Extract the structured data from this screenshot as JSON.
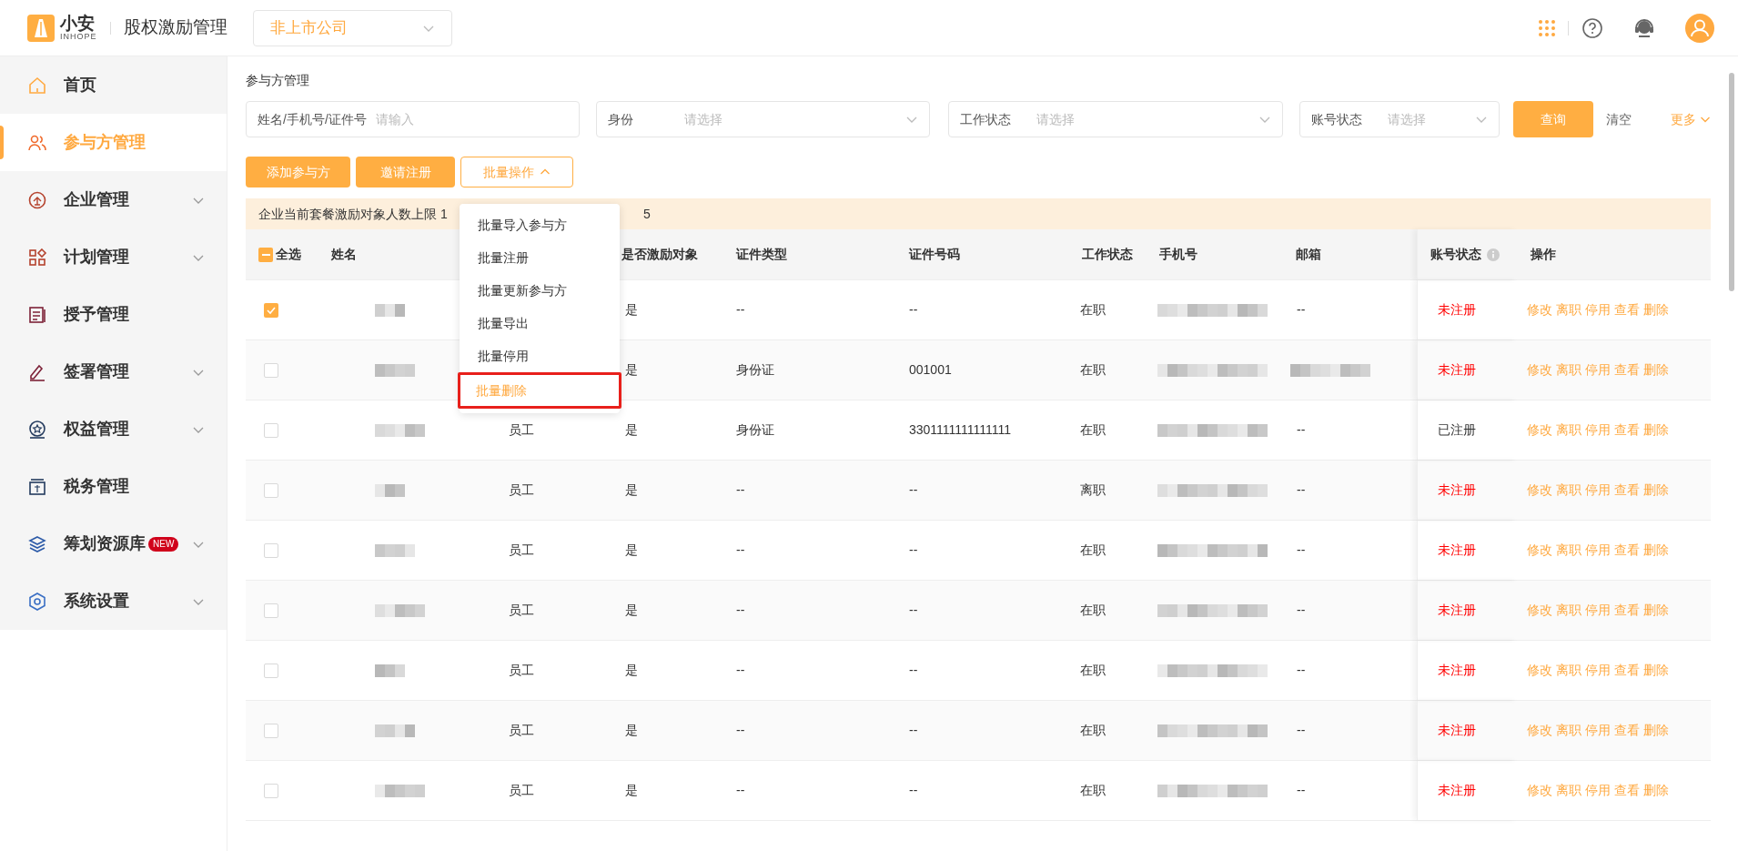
{
  "header": {
    "brand": "小安",
    "brand_sub": "INHOPE",
    "app_title": "股权激励管理",
    "company_select": "非上市公司"
  },
  "sidebar": {
    "items": [
      {
        "label": "首页",
        "selected": false,
        "has_children": false
      },
      {
        "label": "参与方管理",
        "selected": true,
        "has_children": false
      },
      {
        "label": "企业管理",
        "selected": false,
        "has_children": true
      },
      {
        "label": "计划管理",
        "selected": false,
        "has_children": true
      },
      {
        "label": "授予管理",
        "selected": false,
        "has_children": false
      },
      {
        "label": "签署管理",
        "selected": false,
        "has_children": true
      },
      {
        "label": "权益管理",
        "selected": false,
        "has_children": true
      },
      {
        "label": "税务管理",
        "selected": false,
        "has_children": false
      },
      {
        "label": "筹划资源库",
        "selected": false,
        "has_children": true,
        "badge": "NEW"
      },
      {
        "label": "系统设置",
        "selected": false,
        "has_children": true
      }
    ]
  },
  "breadcrumb": "参与方管理",
  "filters": [
    {
      "label": "姓名/手机号/证件号",
      "placeholder": "请输入",
      "kind": "input"
    },
    {
      "label": "身份",
      "placeholder": "请选择",
      "kind": "select"
    },
    {
      "label": "工作状态",
      "placeholder": "请选择",
      "kind": "select"
    },
    {
      "label": "账号状态",
      "placeholder": "请选择",
      "kind": "select"
    }
  ],
  "filter_actions": {
    "query": "查询",
    "clear": "清空",
    "more": "更多"
  },
  "actions": [
    {
      "label": "添加参与方",
      "kind": "primary"
    },
    {
      "label": "邀请注册",
      "kind": "primary"
    },
    {
      "label": "批量操作",
      "kind": "menu",
      "expanded": true
    }
  ],
  "batch_menu": [
    {
      "label": "批量导入参与方",
      "highlighted": false
    },
    {
      "label": "批量注册",
      "highlighted": false
    },
    {
      "label": "批量更新参与方",
      "highlighted": false
    },
    {
      "label": "批量导出",
      "highlighted": false
    },
    {
      "label": "批量停用",
      "highlighted": false
    },
    {
      "label": "批量删除",
      "highlighted": true
    }
  ],
  "notice": {
    "start": "企业当前套餐激励对象人数上限 1",
    "end": "5"
  },
  "table": {
    "select_all": {
      "label": "全选",
      "indeterminate": true
    },
    "columns": [
      "姓名",
      "是否激励对象",
      "证件类型",
      "证件号码",
      "工作状态",
      "手机号",
      "邮箱",
      "账号状态",
      "操作"
    ],
    "rows": [
      {
        "checked": true,
        "incentive": "是",
        "id_type": "--",
        "id_no": "--",
        "work": "在职",
        "email": "--",
        "account": "未注册",
        "registered": false,
        "actions": [
          "修改",
          "离职",
          "停用",
          "查看",
          "删除"
        ]
      },
      {
        "checked": false,
        "incentive": "是",
        "id_type": "身份证",
        "id_no": "001001",
        "work": "在职",
        "email_blurred": true,
        "account": "未注册",
        "registered": false,
        "actions": [
          "修改",
          "离职",
          "停用",
          "查看",
          "删除"
        ]
      },
      {
        "checked": false,
        "identity": "员工",
        "incentive": "是",
        "id_type": "身份证",
        "id_no": "3301111111111111",
        "work": "在职",
        "email": "--",
        "account": "已注册",
        "registered": true,
        "actions": [
          "修改",
          "离职",
          "停用",
          "查看",
          "删除"
        ]
      },
      {
        "checked": false,
        "identity": "员工",
        "incentive": "是",
        "id_type": "--",
        "id_no": "--",
        "work": "离职",
        "email": "--",
        "account": "未注册",
        "registered": false,
        "actions": [
          "修改",
          "离职",
          "停用",
          "查看",
          "删除"
        ]
      },
      {
        "checked": false,
        "identity": "员工",
        "incentive": "是",
        "id_type": "--",
        "id_no": "--",
        "work": "在职",
        "email": "--",
        "account": "未注册",
        "registered": false,
        "actions": [
          "修改",
          "离职",
          "停用",
          "查看",
          "删除"
        ]
      },
      {
        "checked": false,
        "identity": "员工",
        "incentive": "是",
        "id_type": "--",
        "id_no": "--",
        "work": "在职",
        "email": "--",
        "account": "未注册",
        "registered": false,
        "actions": [
          "修改",
          "离职",
          "停用",
          "查看",
          "删除"
        ]
      },
      {
        "checked": false,
        "identity": "员工",
        "incentive": "是",
        "id_type": "--",
        "id_no": "--",
        "work": "在职",
        "email": "--",
        "account": "未注册",
        "registered": false,
        "actions": [
          "修改",
          "离职",
          "停用",
          "查看",
          "删除"
        ]
      },
      {
        "checked": false,
        "identity": "员工",
        "incentive": "是",
        "id_type": "--",
        "id_no": "--",
        "work": "在职",
        "email": "--",
        "account": "未注册",
        "registered": false,
        "actions": [
          "修改",
          "离职",
          "停用",
          "查看",
          "删除"
        ]
      },
      {
        "checked": false,
        "identity": "员工",
        "incentive": "是",
        "id_type": "--",
        "id_no": "--",
        "work": "在职",
        "email": "--",
        "account": "未注册",
        "registered": false,
        "actions": [
          "修改",
          "离职",
          "停用",
          "查看",
          "删除"
        ]
      }
    ]
  }
}
